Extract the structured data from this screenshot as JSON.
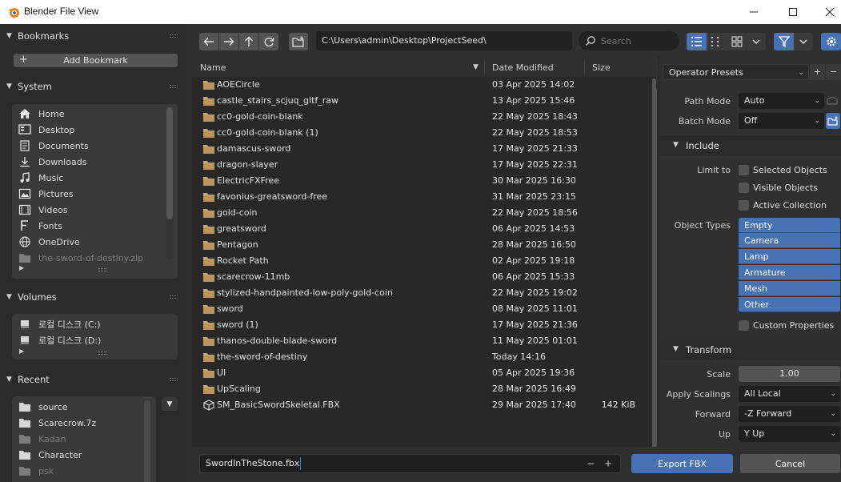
{
  "window": {
    "title": "Blender File View"
  },
  "sidebar": {
    "bookmarks": {
      "title": "Bookmarks",
      "add_label": "Add Bookmark"
    },
    "system": {
      "title": "System",
      "items": [
        {
          "label": "Home",
          "icon": "home-icon"
        },
        {
          "label": "Desktop",
          "icon": "desktop-icon"
        },
        {
          "label": "Documents",
          "icon": "documents-icon"
        },
        {
          "label": "Downloads",
          "icon": "downloads-icon"
        },
        {
          "label": "Music",
          "icon": "music-icon"
        },
        {
          "label": "Pictures",
          "icon": "pictures-icon"
        },
        {
          "label": "Videos",
          "icon": "videos-icon"
        },
        {
          "label": "Fonts",
          "icon": "fonts-icon"
        },
        {
          "label": "OneDrive",
          "icon": "globe-icon"
        },
        {
          "label": "the-sword-of-destiny.zip",
          "icon": "folder-icon"
        }
      ]
    },
    "volumes": {
      "title": "Volumes",
      "items": [
        {
          "label": "로컬 디스크 (C:)"
        },
        {
          "label": "로컬 디스크 (D:)"
        }
      ]
    },
    "recent": {
      "title": "Recent",
      "items": [
        {
          "label": "source"
        },
        {
          "label": "Scarecrow.7z"
        },
        {
          "label": "Kadan"
        },
        {
          "label": "Character"
        },
        {
          "label": "psk"
        }
      ]
    }
  },
  "toolbar": {
    "path": "C:\\Users\\admin\\Desktop\\ProjectSeed\\",
    "search_placeholder": "Search"
  },
  "filelist": {
    "columns": {
      "name": "Name",
      "date": "Date Modified",
      "size": "Size"
    },
    "rows": [
      {
        "name": "AOECircle",
        "date": "03 Apr 2025 14:02",
        "size": "",
        "type": "folder"
      },
      {
        "name": "castle_stairs_scjuq_gltf_raw",
        "date": "13 Apr 2025 15:46",
        "size": "",
        "type": "folder"
      },
      {
        "name": "cc0-gold-coin-blank",
        "date": "22 May 2025 18:43",
        "size": "",
        "type": "folder"
      },
      {
        "name": "cc0-gold-coin-blank (1)",
        "date": "22 May 2025 18:53",
        "size": "",
        "type": "folder"
      },
      {
        "name": "damascus-sword",
        "date": "17 May 2025 21:33",
        "size": "",
        "type": "folder"
      },
      {
        "name": "dragon-slayer",
        "date": "17 May 2025 22:31",
        "size": "",
        "type": "folder"
      },
      {
        "name": "ElectricFXFree",
        "date": "30 Mar 2025 16:30",
        "size": "",
        "type": "folder"
      },
      {
        "name": "favonius-greatsword-free",
        "date": "31 Mar 2025 23:15",
        "size": "",
        "type": "folder"
      },
      {
        "name": "gold-coin",
        "date": "22 May 2025 18:56",
        "size": "",
        "type": "folder"
      },
      {
        "name": "greatsword",
        "date": "06 Apr 2025 14:53",
        "size": "",
        "type": "folder"
      },
      {
        "name": "Pentagon",
        "date": "28 Mar 2025 16:50",
        "size": "",
        "type": "folder"
      },
      {
        "name": "Rocket Path",
        "date": "02 Apr 2025 19:18",
        "size": "",
        "type": "folder"
      },
      {
        "name": "scarecrow-11mb",
        "date": "06 Apr 2025 15:33",
        "size": "",
        "type": "folder"
      },
      {
        "name": "stylized-handpainted-low-poly-gold-coin",
        "date": "22 May 2025 19:02",
        "size": "",
        "type": "folder"
      },
      {
        "name": "sword",
        "date": "08 May 2025 11:01",
        "size": "",
        "type": "folder"
      },
      {
        "name": "sword (1)",
        "date": "17 May 2025 21:36",
        "size": "",
        "type": "folder"
      },
      {
        "name": "thanos-double-blade-sword",
        "date": "11 May 2025 01:01",
        "size": "",
        "type": "folder"
      },
      {
        "name": "the-sword-of-destiny",
        "date": "Today 14:16",
        "size": "",
        "type": "folder"
      },
      {
        "name": "UI",
        "date": "05 Apr 2025 19:36",
        "size": "",
        "type": "folder"
      },
      {
        "name": "UpScaling",
        "date": "28 Mar 2025 16:49",
        "size": "",
        "type": "folder"
      },
      {
        "name": "SM_BasicSwordSkeletal.FBX",
        "date": "29 Mar 2025 17:40",
        "size": "142 KiB",
        "type": "mesh"
      }
    ]
  },
  "bottom": {
    "filename": "SwordInTheStone.fbx",
    "minus": "−",
    "plus": "+",
    "export_label": "Export FBX",
    "cancel_label": "Cancel"
  },
  "options": {
    "presets": "Operator Presets",
    "path_mode_label": "Path Mode",
    "path_mode_value": "Auto",
    "batch_mode_label": "Batch Mode",
    "batch_mode_value": "Off",
    "include": {
      "title": "Include",
      "limit_to_label": "Limit to",
      "limit_options": [
        "Selected Objects",
        "Visible Objects",
        "Active Collection"
      ],
      "object_types_label": "Object Types",
      "object_types": [
        "Empty",
        "Camera",
        "Lamp",
        "Armature",
        "Mesh",
        "Other"
      ],
      "custom_properties": "Custom Properties"
    },
    "transform": {
      "title": "Transform",
      "scale_label": "Scale",
      "scale_value": "1.00",
      "apply_scalings_label": "Apply Scalings",
      "apply_scalings_value": "All Local",
      "forward_label": "Forward",
      "forward_value": "-Z Forward",
      "up_label": "Up",
      "up_value": "Y Up"
    }
  },
  "colors": {
    "accent": "#4772b3",
    "folder": "#c9a66b",
    "panel": "#303030",
    "field": "#1f1f1f"
  }
}
